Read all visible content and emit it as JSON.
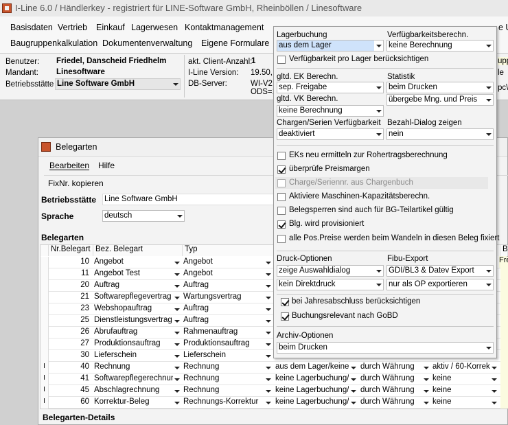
{
  "title_bar": {
    "text": "I-Line 6.0  /  Händlerkey - registriert für LINE-Software GmbH, Rheinböllen  /  Linesoftware"
  },
  "menu_row1": [
    "Basisdaten",
    "Vertrieb",
    "Einkauf",
    "Lagerwesen",
    "Kontaktmanagement"
  ],
  "menu_row2": [
    "Baugruppenkalkulation",
    "Dokumentenverwaltung",
    "Eigene Formulare"
  ],
  "menu_right": {
    "r1": "e U",
    "r2": ""
  },
  "info": {
    "benutzer_label": "Benutzer:",
    "benutzer_value": "Friedel, Danscheid Friedhelm",
    "mandant_label": "Mandant:",
    "mandant_value": "Linesoftware",
    "betriebsstaette_label": "Betriebsstätte",
    "betriebsstaette_value": "Line Software GmbH",
    "client_label": "akt. Client-Anzahl:",
    "client_value": "1",
    "version_label": "I-Line Version:",
    "version_value": "19.50,",
    "db_label": "DB-Server:",
    "db_value": "WI-V2.",
    "ods_value": "ODS=1",
    "right_frag1": "upp",
    "right_frag2": "le",
    "right_frag3": "pc\\"
  },
  "child": {
    "title": "Belegarten",
    "menu_edit": "Bearbeiten",
    "menu_help": "Hilfe",
    "fixnr": "FixNr. kopieren",
    "betriebsstaette_label": "Betriebsstätte",
    "betriebsstaette_value": "Line Software GmbH",
    "sprache_label": "Sprache",
    "sprache_value": "deutsch",
    "belegarten_label": "Belegarten",
    "details_label": "Belegarten-Details",
    "col_nr": "Nr.Belegart",
    "col_bez": "Bez. Belegart",
    "col_typ": "Typ",
    "col_bl": "Bl",
    "col_fre": "Fre",
    "rows": [
      {
        "nr": "10",
        "bez": "Angebot",
        "typ": "Angebot",
        "lager": "",
        "waehrung": "",
        "status": ""
      },
      {
        "nr": "11",
        "bez": "Angebot Test",
        "typ": "Angebot",
        "lager": "",
        "waehrung": "",
        "status": ""
      },
      {
        "nr": "20",
        "bez": "Auftrag",
        "typ": "Auftrag",
        "lager": "",
        "waehrung": "",
        "status": ""
      },
      {
        "nr": "21",
        "bez": "Softwarepflegevertrag",
        "typ": "Wartungsvertrag",
        "lager": "",
        "waehrung": "",
        "status": ""
      },
      {
        "nr": "23",
        "bez": "Webshopauftrag",
        "typ": "Auftrag",
        "lager": "",
        "waehrung": "",
        "status": ""
      },
      {
        "nr": "25",
        "bez": "Dienstleistungsvertrag",
        "typ": "Auftrag",
        "lager": "",
        "waehrung": "",
        "status": ""
      },
      {
        "nr": "26",
        "bez": "Abrufauftrag",
        "typ": "Rahmenauftrag",
        "lager": "",
        "waehrung": "",
        "status": ""
      },
      {
        "nr": "27",
        "bez": "Produktionsauftrag",
        "typ": "Produktionsauftrag",
        "lager": "",
        "waehrung": "",
        "status": ""
      },
      {
        "nr": "30",
        "bez": "Lieferschein",
        "typ": "Lieferschein",
        "lager": "",
        "waehrung": "",
        "status": ""
      },
      {
        "nr": "40",
        "bez": "Rechnung",
        "typ": "Rechnung",
        "lager": "aus dem Lager/keine",
        "waehrung": "durch Währung",
        "status": "aktiv / 60-Korrek"
      },
      {
        "nr": "41",
        "bez": "Softwarepflegerechnung",
        "typ": "Rechnung",
        "lager": "keine Lagerbuchung/k",
        "waehrung": "durch Währung",
        "status": "keine"
      },
      {
        "nr": "45",
        "bez": "Abschlagrechnung",
        "typ": "Rechnung",
        "lager": "keine Lagerbuchung/k",
        "waehrung": "durch Währung",
        "status": "keine"
      },
      {
        "nr": "60",
        "bez": "Korrektur-Beleg",
        "typ": "Rechnungs-Korrektur",
        "lager": "keine Lagerbuchung/k",
        "waehrung": "durch Währung",
        "status": "keine"
      }
    ],
    "row_marker": "I"
  },
  "overlay": {
    "lagerbuchung_label": "Lagerbuchung",
    "lagerbuchung_value": "aus dem Lager",
    "verfueg_label": "Verfügbarkeitsberechn.",
    "verfueg_value": "keine Berechnung",
    "verfueg_lager_cb": "Verfügbarkeit pro Lager berücksichtigen",
    "ek_label": "gltd. EK Berechn.",
    "ek_value": "sep. Freigabe",
    "statistik_label": "Statistik",
    "statistik_value": "beim Drucken",
    "vk_label": "gltd. VK Berechn.",
    "vk_value": "keine Berechnung",
    "statistik2_value": "übergebe Mng. und Preis",
    "chargen_label": "Chargen/Serien Verfügbarkeit",
    "chargen_value": "deaktiviert",
    "bezahl_label": "Bezahl-Dialog zeigen",
    "bezahl_value": "nein",
    "checks": [
      {
        "label": "EKs neu ermitteln zur Rohertragsberechnung",
        "checked": false,
        "disabled": false
      },
      {
        "label": "überprüfe Preismargen",
        "checked": true,
        "disabled": false
      },
      {
        "label": "Charge/Seriennr. aus Chargenbuch",
        "checked": false,
        "disabled": true
      },
      {
        "label": "Aktiviere Maschinen-Kapazitätsberechn.",
        "checked": false,
        "disabled": false
      },
      {
        "label": "Belegsperren sind auch für BG-Teilartikel gültig",
        "checked": false,
        "disabled": false
      },
      {
        "label": "Blg. wird provisioniert",
        "checked": true,
        "disabled": false
      },
      {
        "label": "alle Pos.Preise werden beim Wandeln in diesen Beleg fixiert",
        "checked": false,
        "disabled": false
      }
    ],
    "druck_label": "Druck-Optionen",
    "druck_value": "zeige Auswahldialog",
    "fibu_label": "Fibu-Export",
    "fibu_value": "GDI/BL3 & Datev Export",
    "direktdruck_value": "kein Direktdruck",
    "op_value": "nur als OP exportieren",
    "jahres_cb": "bei Jahresabschluss berücksichtigen",
    "gobd_cb": "Buchungsrelevant nach GoBD",
    "archiv_label": "Archiv-Optionen",
    "archiv_value": "beim Drucken"
  }
}
